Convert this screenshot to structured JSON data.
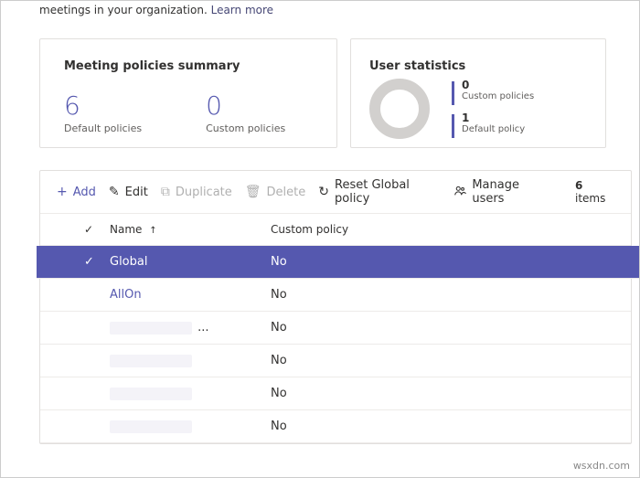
{
  "intro": {
    "text": "meetings in your organization.",
    "link": "Learn more"
  },
  "summary": {
    "title": "Meeting policies summary",
    "default_count": "6",
    "default_label": "Default policies",
    "custom_count": "0",
    "custom_label": "Custom policies"
  },
  "stats": {
    "title": "User statistics",
    "custom_value": "0",
    "custom_label": "Custom policies",
    "default_value": "1",
    "default_label": "Default policy"
  },
  "toolbar": {
    "add": "Add",
    "edit": "Edit",
    "duplicate": "Duplicate",
    "delete": "Delete",
    "reset": "Reset Global policy",
    "manage": "Manage users",
    "count_num": "6",
    "count_label": "items"
  },
  "columns": {
    "name": "Name",
    "custom": "Custom policy"
  },
  "rows": [
    {
      "selected": true,
      "name": "Global",
      "blurred": false,
      "ellipsis": false,
      "custom": "No"
    },
    {
      "selected": false,
      "name": "AllOn",
      "blurred": false,
      "ellipsis": false,
      "custom": "No"
    },
    {
      "selected": false,
      "name": "",
      "blurred": true,
      "ellipsis": true,
      "custom": "No"
    },
    {
      "selected": false,
      "name": "",
      "blurred": true,
      "ellipsis": false,
      "custom": "No"
    },
    {
      "selected": false,
      "name": "",
      "blurred": true,
      "ellipsis": false,
      "custom": "No"
    },
    {
      "selected": false,
      "name": "",
      "blurred": true,
      "ellipsis": false,
      "custom": "No"
    }
  ],
  "watermark": "wsxdn.com"
}
